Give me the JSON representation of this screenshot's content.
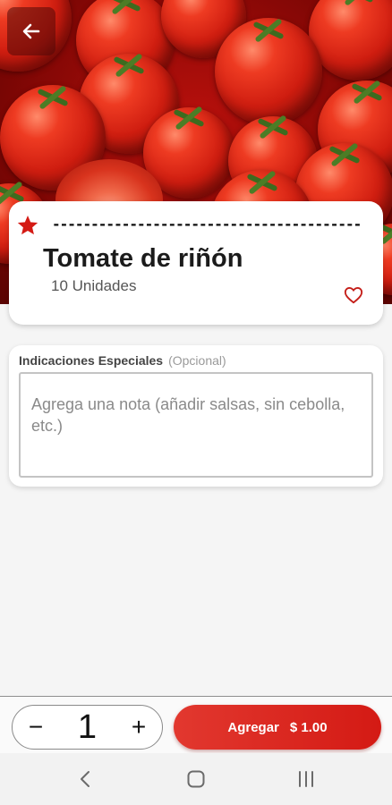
{
  "header": {
    "back_icon": "arrow-left-icon",
    "hero_image": "tomatoes-photo"
  },
  "product": {
    "badge_icon": "star-icon",
    "dashes": "----------------------------------------",
    "title": "Tomate de riñón",
    "units": "10 Unidades",
    "favorite_icon": "heart-outline-icon"
  },
  "notes": {
    "label": "Indicaciones Especiales",
    "optional_label": "(Opcional)",
    "placeholder": "Agrega una nota (añadir salsas, sin cebolla, etc.)"
  },
  "order": {
    "minus": "−",
    "quantity": "1",
    "plus": "+",
    "add_label": "Agregar",
    "price": "$ 1.00"
  },
  "system_nav": {
    "back_icon": "chevron-left-icon",
    "home_icon": "home-square-icon",
    "recents_icon": "recents-icon"
  },
  "colors": {
    "accent": "#d41a14",
    "background": "#f5f5f5"
  }
}
